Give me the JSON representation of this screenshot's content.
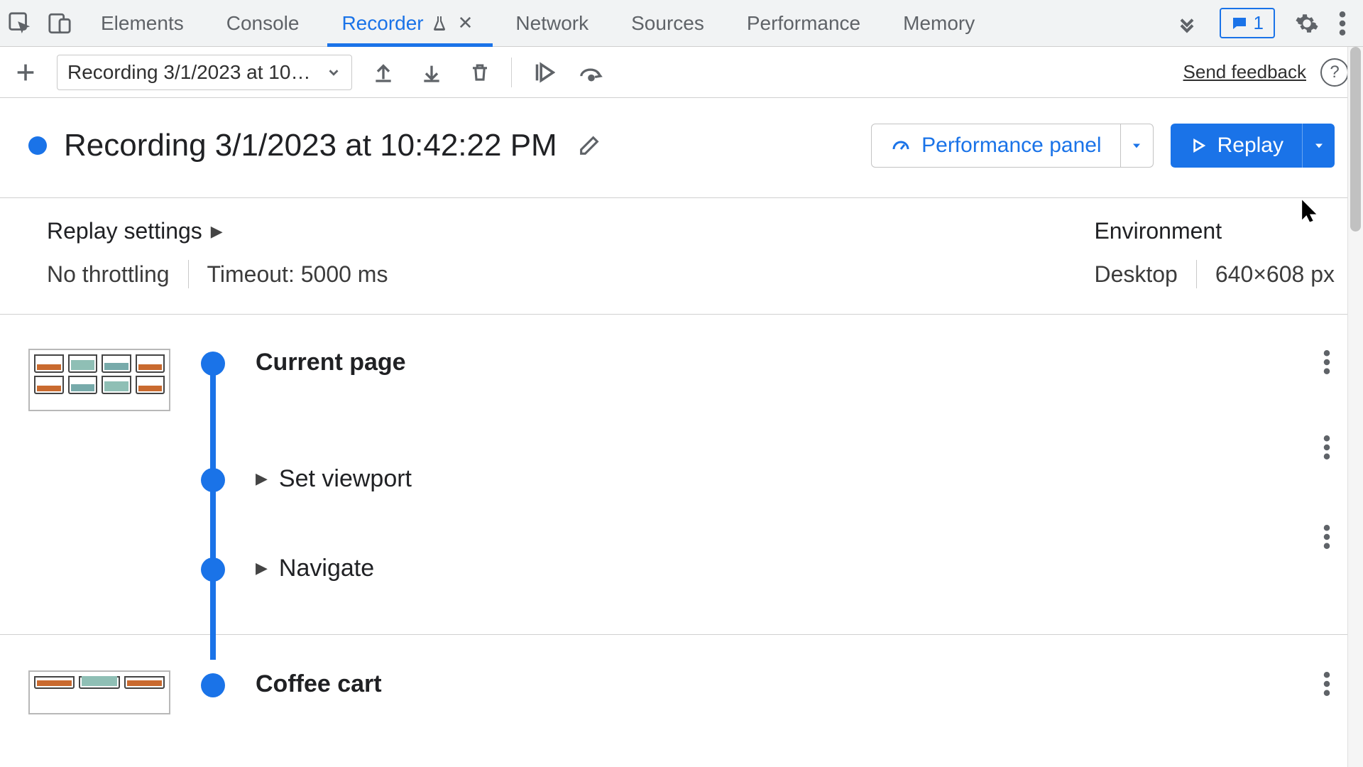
{
  "tabs": {
    "items": [
      "Elements",
      "Console",
      "Recorder",
      "Network",
      "Sources",
      "Performance",
      "Memory"
    ],
    "activeIndex": 2
  },
  "notification_count": "1",
  "subbar": {
    "dropdown_label": "Recording 3/1/2023 at 10…"
  },
  "feedback_label": "Send feedback",
  "recording": {
    "title": "Recording 3/1/2023 at 10:42:22 PM"
  },
  "perf_button": "Performance panel",
  "replay_button": "Replay",
  "replay_settings": {
    "title": "Replay settings",
    "throttling": "No throttling",
    "timeout": "Timeout: 5000 ms"
  },
  "environment": {
    "title": "Environment",
    "device": "Desktop",
    "viewport": "640×608 px"
  },
  "steps": {
    "s0": "Current page",
    "s1": "Set viewport",
    "s2": "Navigate",
    "s3_title": "Coffee cart"
  }
}
